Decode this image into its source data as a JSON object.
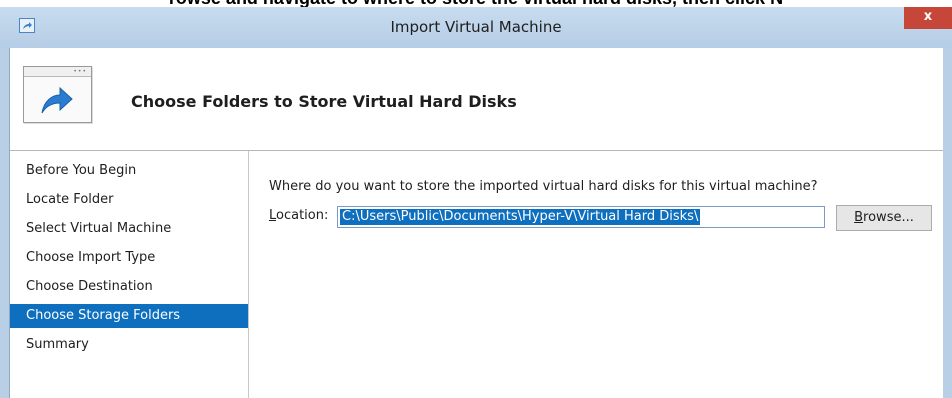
{
  "page_caption": "rowse and navigate to where to store the virtual hard disks, then click N",
  "window": {
    "title": "Import Virtual Machine",
    "close_glyph": "x"
  },
  "header": {
    "title": "Choose Folders to Store Virtual Hard Disks"
  },
  "nav": {
    "items": [
      {
        "label": "Before You Begin",
        "selected": false
      },
      {
        "label": "Locate Folder",
        "selected": false
      },
      {
        "label": "Select Virtual Machine",
        "selected": false
      },
      {
        "label": "Choose Import Type",
        "selected": false
      },
      {
        "label": "Choose Destination",
        "selected": false
      },
      {
        "label": "Choose Storage Folders",
        "selected": true
      },
      {
        "label": "Summary",
        "selected": false
      }
    ]
  },
  "main": {
    "question": "Where do you want to store the imported virtual hard disks for this virtual machine?",
    "location": {
      "label_access_key": "L",
      "label_rest": "ocation:",
      "value": "C:\\Users\\Public\\Documents\\Hyper-V\\Virtual Hard Disks\\"
    },
    "browse": {
      "access_key": "B",
      "rest": "rowse..."
    }
  },
  "colors": {
    "selection": "#0e6fbf",
    "titlebar": "#c8dcef",
    "close_button": "#c7463a"
  },
  "icons": [
    "import-vm-app-icon",
    "close-icon",
    "import-wizard-icon",
    "arrow-icon"
  ]
}
